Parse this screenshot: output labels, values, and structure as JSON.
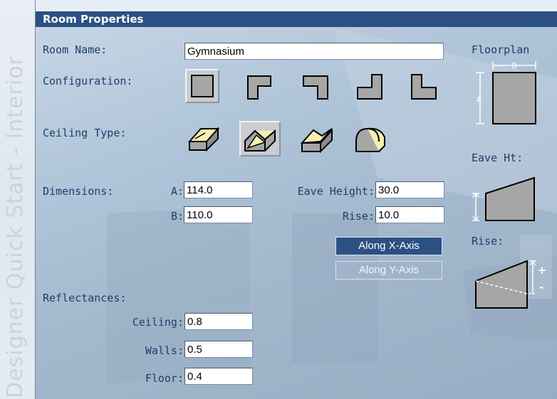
{
  "sidebar": {
    "title": "Designer Quick Start - Interior"
  },
  "panel": {
    "title": "Room Properties",
    "room_name": {
      "label": "Room Name:",
      "value": "Gymnasium"
    },
    "configuration": {
      "label": "Configuration:",
      "options": [
        "square-icon",
        "l-shape-icon",
        "reverse-l-icon",
        "step-shape-icon",
        "corner-l-icon"
      ],
      "selected": 0
    },
    "ceiling": {
      "label": "Ceiling Type:",
      "options": [
        "flat-ceiling-icon",
        "gable-ceiling-icon",
        "notch-ceiling-icon",
        "arch-ceiling-icon"
      ],
      "selected": 1
    },
    "dimensions": {
      "label": "Dimensions:",
      "a_label": "A:",
      "a_value": "114.0",
      "b_label": "B:",
      "b_value": "110.0",
      "eave_label": "Eave Height:",
      "eave_value": "30.0",
      "rise_label": "Rise:",
      "rise_value": "10.0"
    },
    "axis": {
      "x_label": "Along X-Axis",
      "y_label": "Along Y-Axis",
      "selected": "x"
    },
    "reflectances": {
      "label": "Reflectances:",
      "ceiling_label": "Ceiling:",
      "ceiling_value": "0.8",
      "walls_label": "Walls:",
      "walls_value": "0.5",
      "floor_label": "Floor:",
      "floor_value": "0.4"
    },
    "diagrams": {
      "floorplan_label": "Floorplan",
      "floorplan_a": "A",
      "floorplan_b": "B",
      "eave_label": "Eave Ht:",
      "rise_label": "Rise:",
      "rise_plus": "+",
      "rise_minus": "-"
    }
  },
  "colors": {
    "title_bg": "#2b5084",
    "label_text": "#1e3d6b",
    "panel_bg": "#afc4d8",
    "ceiling_fill": "#f7efb0"
  }
}
